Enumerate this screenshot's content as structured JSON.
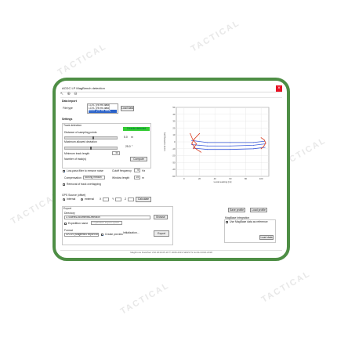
{
  "watermark": {
    "text": "TACTICAL"
  },
  "window": {
    "title": "ACDC LP MagBench detection"
  },
  "toolbar": {
    "items": [
      "↖",
      "⊕",
      "⊖"
    ]
  },
  "data_import": {
    "section_label": "Data import",
    "file_type_label": "File type",
    "file_type_options": [
      "LCVL (V6 ms data)",
      "LCVL (V6 ms data)",
      "MSDF (V6 ms data)"
    ],
    "load_button": "Load data"
  },
  "settings": {
    "section_label": "Settings",
    "track_detection_label": "Track detection",
    "status_badge": "0 tracks detected",
    "sampling_distance_label": "Distance of sampling points",
    "sampling_distance_value": "5.0",
    "sampling_distance_unit": "m",
    "max_deviation_label": "Maximum allowed deviation",
    "max_deviation_value": "25.0",
    "max_deviation_unit": "°",
    "min_track_length_label": "Minimum track length",
    "min_track_length_value": "50",
    "num_tracks_label": "Number of track(s)",
    "compute_button": "Compute",
    "lowpass_label": "Low-pass filter to remove noise",
    "cutoff_label": "Cutoff frequency",
    "cutoff_value": "5",
    "cutoff_unit": "Hz",
    "compensation_label": "Compensation",
    "compensation_value": "Moving median",
    "window_length_label": "Window length",
    "window_length_value": "25",
    "window_length_unit": "m",
    "removal_label": "Removal of track overlapping",
    "slider_levels": {
      "sampling": 0.55,
      "deviation": 0.5
    }
  },
  "gps": {
    "section_label": "GPS Source (offset)",
    "internal_label": "Internal",
    "external_label": "external",
    "x_label": "X",
    "y_label": "Y",
    "z_label": "Z",
    "button": "Calculate"
  },
  "export": {
    "section_label": "Export",
    "directory_label": "Directory",
    "directory_value": "C:\\Users\\Documents\\Detection",
    "browse_button": "Browse",
    "expedition_label": "Expedition name",
    "expedition_placeholder": "Expedition export option",
    "format_label": "Format",
    "format_value": "LVCSV (Magnetic4 export format)",
    "preview_label": "Create preview",
    "initialization_text": "Initialization...",
    "export_button": "Export"
  },
  "profile": {
    "save_button": "Save profile",
    "load_button": "Load profile",
    "integration_label": "MagBase Integration",
    "use_magbase_label": "Use MagBase data as reference",
    "load_data_button": "Load data"
  },
  "plot": {
    "file_label": "2016-11-16_10-12-04.jasad",
    "xlabel": "Local easting [m]",
    "ylabel": "Local northing [m]",
    "x_ticks": [
      "0",
      "20",
      "40",
      "60",
      "80",
      "100"
    ],
    "y_ticks": [
      "50",
      "40",
      "30",
      "20",
      "10",
      "0",
      "-10",
      "-20",
      "-30",
      "-40",
      "-50"
    ]
  },
  "chart_data": {
    "type": "line",
    "xlabel": "Local easting [m]",
    "ylabel": "Local northing [m]",
    "xlim": [
      -10,
      110
    ],
    "ylim": [
      -50,
      50
    ],
    "grid": true,
    "series": [
      {
        "color": "#3b5bdb",
        "x": [
          10,
          30,
          60,
          90,
          105
        ],
        "y": [
          2,
          -1,
          -1,
          -1,
          1
        ]
      },
      {
        "color": "#3b5bdb",
        "x": [
          10,
          30,
          60,
          90,
          105
        ],
        "y": [
          -4,
          -6,
          -6,
          -5,
          -3
        ]
      },
      {
        "color": "#3b5bdb",
        "x": [
          12,
          30,
          60,
          90,
          105
        ],
        "y": [
          -9,
          -11,
          -11,
          -10,
          -8
        ]
      },
      {
        "color": "#d93a1e",
        "x": [
          20,
          14,
          10,
          14,
          22
        ],
        "y": [
          12,
          5,
          -2,
          -9,
          -15
        ]
      },
      {
        "color": "#d93a1e",
        "x": [
          8,
          11,
          16,
          12
        ],
        "y": [
          12,
          4,
          -3,
          -10
        ]
      },
      {
        "color": "#d93a1e",
        "x": [
          100,
          104,
          106,
          103,
          100
        ],
        "y": [
          6,
          3,
          -2,
          -7,
          -10
        ]
      }
    ]
  },
  "status": {
    "text": "MagDrone DataTool V32.2016.05.18 © 2008-2019 SENSYS GmbH 2016-2018"
  },
  "colors": {
    "frame": "#4e8e45",
    "accent_green": "#33cc33",
    "series_blue": "#3b5bdb",
    "series_red": "#d93a1e"
  }
}
